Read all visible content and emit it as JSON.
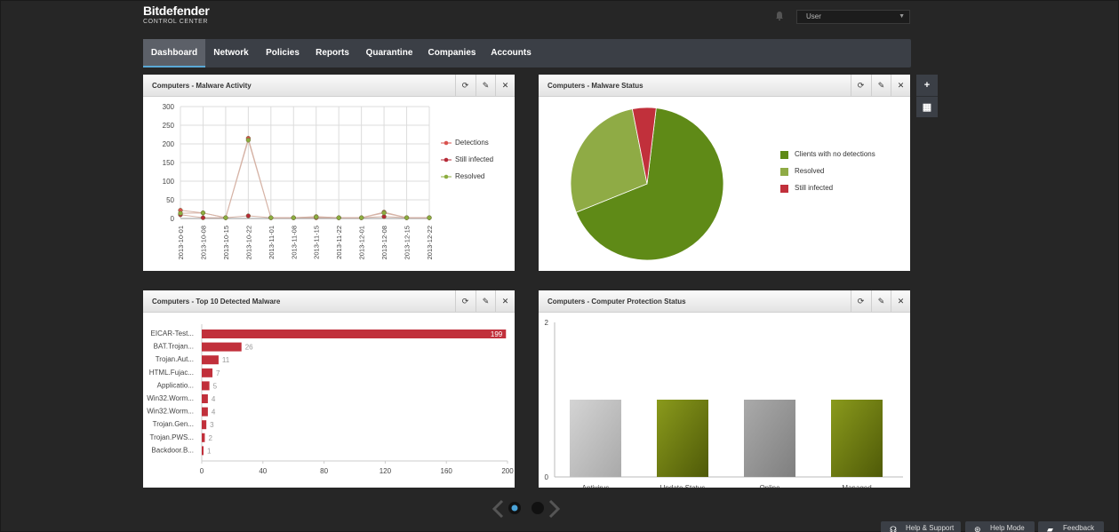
{
  "brand": {
    "name": "Bitdefender",
    "subtitle": "CONTROL CENTER"
  },
  "user_select": {
    "value": "User"
  },
  "nav": [
    "Dashboard",
    "Network",
    "Policies",
    "Reports",
    "Quarantine",
    "Companies",
    "Accounts"
  ],
  "side_buttons": {
    "add": "+",
    "grid": "▦"
  },
  "widgets": {
    "activity": {
      "title": "Computers - Malware Activity"
    },
    "status": {
      "title": "Computers - Malware Status"
    },
    "top10": {
      "title": "Computers - Top 10 Detected Malware"
    },
    "protection": {
      "title": "Computers - Computer Protection Status"
    }
  },
  "widget_buttons": {
    "refresh": "⟳",
    "edit": "✎",
    "close": "✕"
  },
  "footer": {
    "help_support": "Help & Support",
    "help_mode": "Help Mode",
    "feedback": "Feedback"
  },
  "colors": {
    "detections": "#d9534f",
    "still_infected": "#b52a37",
    "resolved": "#8cad3f",
    "pie_clean": "#5f8a17",
    "pie_resolved": "#8fab45",
    "pie_infected": "#c1303b",
    "bar_red": "#c1303b",
    "bar_grey": "#c4c4c4",
    "bar_olive": "#6f7f12",
    "bar_grey_dark": "#999999"
  },
  "chart_data": [
    {
      "type": "line",
      "x": [
        "2013-10-01",
        "2013-10-08",
        "2013-10-15",
        "2013-10-22",
        "2013-11-01",
        "2013-11-08",
        "2013-11-15",
        "2013-11-22",
        "2013-12-01",
        "2013-12-08",
        "2013-12-15",
        "2013-12-22"
      ],
      "ylim": [
        0,
        300
      ],
      "yticks": [
        "0",
        "50",
        "100",
        "150",
        "200",
        "250",
        "300"
      ],
      "series": [
        {
          "name": "Detections",
          "values": [
            22,
            15,
            2,
            215,
            2,
            2,
            5,
            2,
            2,
            17,
            2,
            2
          ]
        },
        {
          "name": "Still infected",
          "values": [
            10,
            2,
            2,
            7,
            2,
            2,
            2,
            2,
            2,
            5,
            2,
            2
          ]
        },
        {
          "name": "Resolved",
          "values": [
            14,
            15,
            2,
            210,
            2,
            2,
            4,
            2,
            2,
            15,
            2,
            2
          ]
        }
      ],
      "legend": "right",
      "grid": true
    },
    {
      "type": "pie",
      "series": [
        {
          "name": "Clients with no detections",
          "value": 67
        },
        {
          "name": "Resolved",
          "value": 28
        },
        {
          "name": "Still infected",
          "value": 5
        }
      ],
      "legend": "right"
    },
    {
      "type": "bar",
      "orientation": "horizontal",
      "categories": [
        "EICAR-Test...",
        "BAT.Trojan...",
        "Trojan.Aut...",
        "HTML.Fujac...",
        "Applicatio...",
        "Win32.Worm...",
        "Win32.Worm...",
        "Trojan.Gen...",
        "Trojan.PWS...",
        "Backdoor.B..."
      ],
      "values": [
        199,
        26,
        11,
        7,
        5,
        4,
        4,
        3,
        2,
        1
      ],
      "xlim": [
        0,
        200
      ],
      "xticks": [
        "0",
        "40",
        "80",
        "120",
        "160",
        "200"
      ]
    },
    {
      "type": "bar",
      "categories": [
        "Antivirus",
        "Update Status",
        "Online",
        "Managed"
      ],
      "values": [
        1,
        1,
        1,
        1
      ],
      "ylim": [
        0,
        2
      ],
      "yticks": [
        "0",
        "2"
      ]
    }
  ]
}
